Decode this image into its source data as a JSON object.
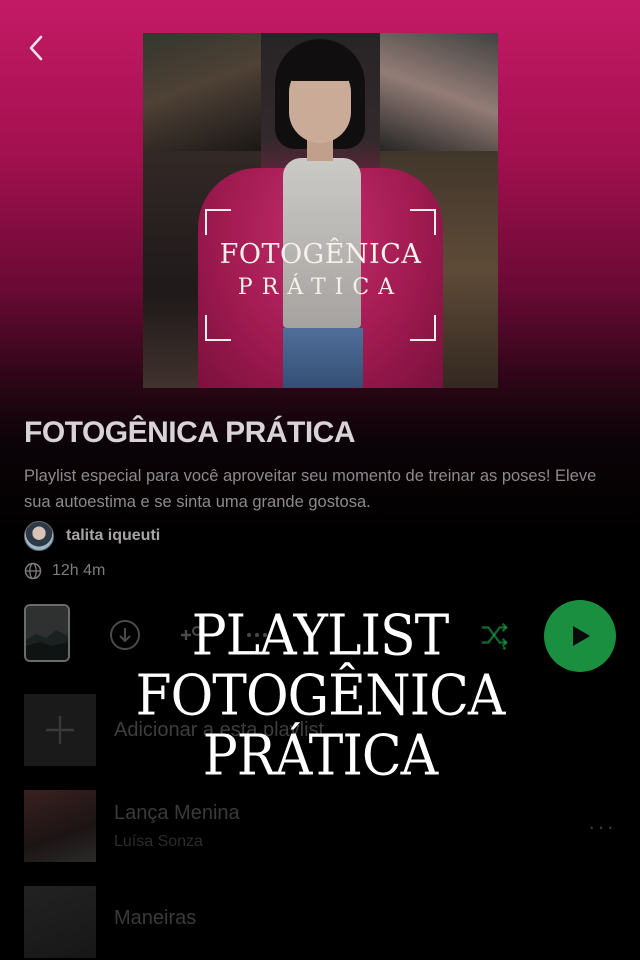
{
  "nav": {
    "back_label": "Voltar"
  },
  "cover": {
    "title_line1": "FOTOGÊNICA",
    "title_line2": "PRÁTICA"
  },
  "playlist": {
    "title": "FOTOGÊNICA PRÁTICA",
    "description": "Playlist especial para você aproveitar seu momento de treinar as poses! Eleve sua autoestima e se sinta uma grande gostosa.",
    "owner": "talita iqueuti",
    "duration": "12h 4m"
  },
  "controls": {
    "download_icon": "download-icon",
    "add_user_icon": "add-user-icon",
    "more_icon": "more-icon",
    "shuffle_icon": "shuffle-icon",
    "play_icon": "play-icon"
  },
  "add_row": {
    "label": "Adicionar a esta playlist"
  },
  "tracks": [
    {
      "title": "Lança Menina",
      "artist": "Luísa Sonza"
    },
    {
      "title": "Maneiras",
      "artist": ""
    }
  ],
  "overlay": {
    "line1": "PLAYLIST",
    "line2": "FOTOGÊNICA",
    "line3": "PRÁTICA"
  },
  "colors": {
    "gradient_top": "#c41a66",
    "accent_green": "#1a8f3f",
    "shuffle_green": "#1db954"
  }
}
